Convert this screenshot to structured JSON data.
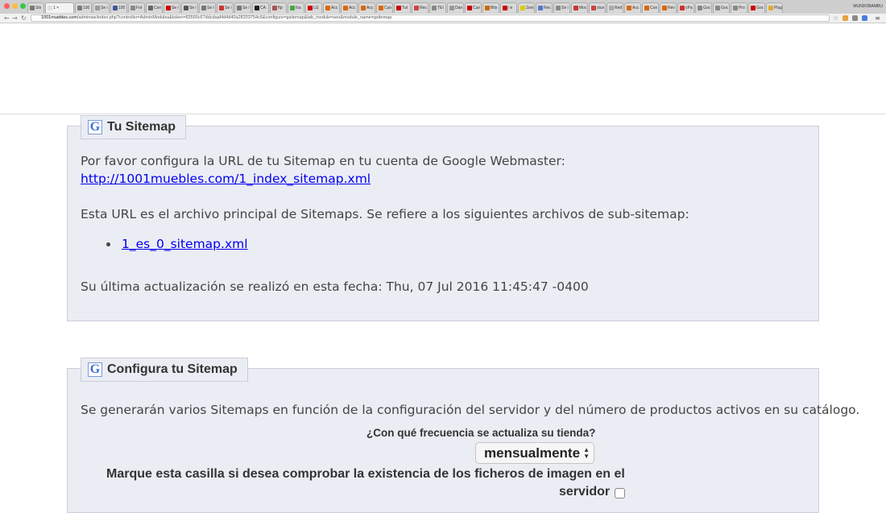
{
  "browser": {
    "tabs": [
      {
        "label": "Sitı",
        "color": "#7a7a7a"
      },
      {
        "label": "1 ×",
        "color": "#e0e0e0",
        "active": true
      },
      {
        "label": "100",
        "color": "#7a7a7a"
      },
      {
        "label": "Se i",
        "color": "#999999"
      },
      {
        "label": "100",
        "color": "#3b5998"
      },
      {
        "label": "Fot",
        "color": "#888888"
      },
      {
        "label": "Con",
        "color": "#666666"
      },
      {
        "label": "Se i",
        "color": "#cc0000"
      },
      {
        "label": "Se i",
        "color": "#555555"
      },
      {
        "label": "Se i",
        "color": "#777777"
      },
      {
        "label": "Se i",
        "color": "#cc3333"
      },
      {
        "label": "Se i",
        "color": "#777777"
      },
      {
        "label": "CA",
        "color": "#222222"
      },
      {
        "label": "ftp:",
        "color": "#aa5555"
      },
      {
        "label": "fsa",
        "color": "#44aa44"
      },
      {
        "label": "LG",
        "color": "#cc0000"
      },
      {
        "label": "Acc",
        "color": "#dd6600"
      },
      {
        "label": "Acc",
        "color": "#dd6600"
      },
      {
        "label": "Acc",
        "color": "#dd6600"
      },
      {
        "label": "Cun",
        "color": "#dd6600"
      },
      {
        "label": "Tut",
        "color": "#cc0000"
      },
      {
        "label": "Rec",
        "color": "#cc4444"
      },
      {
        "label": "TEI",
        "color": "#888888"
      },
      {
        "label": "Dan",
        "color": "#999999"
      },
      {
        "label": "Cun",
        "color": "#cc0000"
      },
      {
        "label": "Bits",
        "color": "#cc6600"
      },
      {
        "label": "i e",
        "color": "#cc0000"
      },
      {
        "label": "Zeis",
        "color": "#ddcc00"
      },
      {
        "label": "Rec",
        "color": "#5577cc"
      },
      {
        "label": "Se i",
        "color": "#888888"
      },
      {
        "label": "Moc",
        "color": "#cc3333"
      },
      {
        "label": "stuv",
        "color": "#cc4444"
      },
      {
        "label": "Red",
        "color": "#aaaaaa"
      },
      {
        "label": "Acc",
        "color": "#dd6600"
      },
      {
        "label": "Con",
        "color": "#dd6600"
      },
      {
        "label": "Rev",
        "color": "#dd6600"
      },
      {
        "label": "cPa",
        "color": "#cc3333"
      },
      {
        "label": "Goc",
        "color": "#888888"
      },
      {
        "label": "Goc",
        "color": "#888888"
      },
      {
        "label": "Pro",
        "color": "#888888"
      },
      {
        "label": "Goc",
        "color": "#cc0000"
      },
      {
        "label": "Plug",
        "color": "#ddaa33"
      }
    ],
    "profile_name": "MUNDOBAMBU",
    "url": {
      "host": "1001muebles.com",
      "path": "/adminwe/index.php?controller=AdminModules&token=83590c67ddcdaaf4d4d40a28203754c6&configure=gsitemap&tab_module=seo&module_name=gsitemap"
    },
    "colors": {
      "close": "#fc605c",
      "minimize": "#fdbc40",
      "maximize": "#34c84a"
    }
  },
  "sitemap_panel": {
    "title": "Tu Sitemap",
    "intro": "Por favor configura la URL de tu Sitemap en tu cuenta de Google Webmaster:",
    "sitemap_url": "http://1001muebles.com/1_index_sitemap.xml",
    "subsitemap_text": "Esta URL es el archivo principal de Sitemaps. Se refiere a los siguientes archivos de sub-sitemap:",
    "subsitemaps": [
      "1_es_0_sitemap.xml"
    ],
    "last_update": "Su última actualización se realizó en esta fecha: Thu, 07 Jul 2016 11:45:47 -0400"
  },
  "config_panel": {
    "title": "Configura tu Sitemap",
    "description": "Se generarán varios Sitemaps en función de la configuración del servidor y del número de productos activos en su catálogo.",
    "frequency_label": "¿Con qué frecuencia se actualiza su tienda?",
    "frequency_value": "mensualmente",
    "image_check_label_line1": "Marque esta casilla si desea comprobar la existencia de los ficheros de imagen en el",
    "image_check_label_line2": "servidor",
    "image_check_checked": false
  }
}
